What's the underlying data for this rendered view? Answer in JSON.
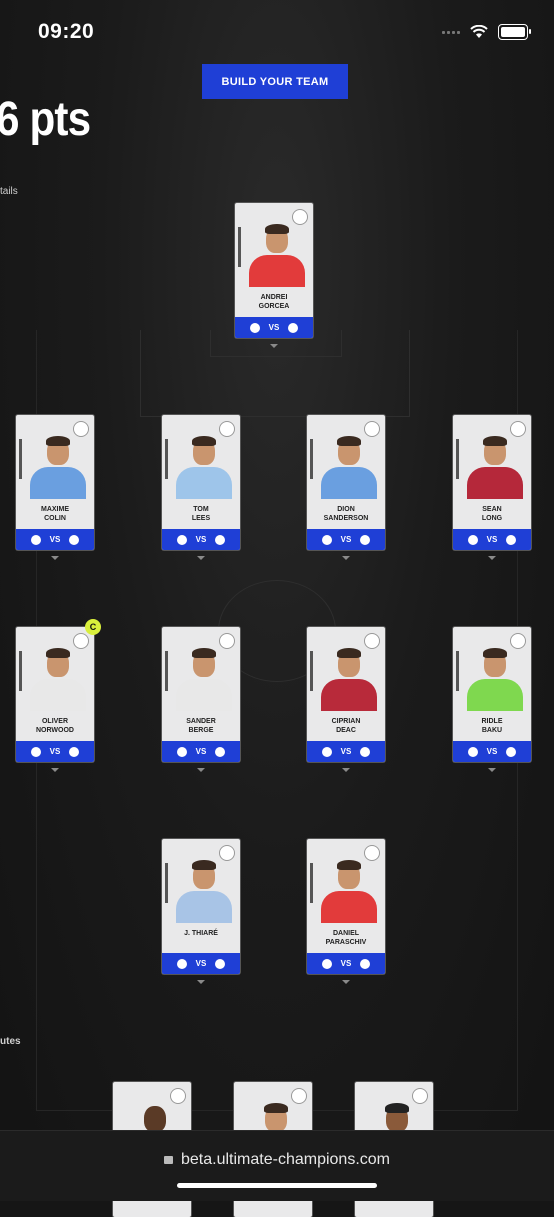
{
  "status_bar": {
    "time": "09:20"
  },
  "header": {
    "build_button": "BUILD YOUR TEAM",
    "points_text": "6 pts",
    "details_text": "tails"
  },
  "subs_label": "utes",
  "players": [
    {
      "id": "gk",
      "first": "ANDREI",
      "last": "GORCEA",
      "shirt": "#e23b3b",
      "crest": "U",
      "home": "U",
      "away": "⚑"
    },
    {
      "id": "d1",
      "first": "MAXIME",
      "last": "COLIN",
      "shirt": "#6a9fe0",
      "crest": "",
      "home": "",
      "away": "●"
    },
    {
      "id": "d2",
      "first": "TOM",
      "last": "LEES",
      "shirt": "#9ec5ea",
      "crest": "",
      "home": "",
      "away": "●"
    },
    {
      "id": "d3",
      "first": "DION",
      "last": "SANDERSON",
      "shirt": "#6a9fe0",
      "crest": "",
      "home": "",
      "away": "●"
    },
    {
      "id": "d4",
      "first": "SEAN",
      "last": "LONG",
      "shirt": "#b5283a",
      "crest": "",
      "home": "",
      "away": "●"
    },
    {
      "id": "m1",
      "first": "OLIVER",
      "last": "NORWOOD",
      "shirt": "#e8e8e8",
      "crest": "",
      "home": "",
      "away": "●"
    },
    {
      "id": "m2",
      "first": "SANDER",
      "last": "BERGE",
      "shirt": "#e8e8e8",
      "crest": "",
      "home": "",
      "away": "●"
    },
    {
      "id": "m3",
      "first": "CIPRIAN",
      "last": "DEAC",
      "shirt": "#b82a3a",
      "crest": "",
      "home": "",
      "away": "●"
    },
    {
      "id": "m4",
      "first": "RIDLE",
      "last": "BAKU",
      "shirt": "#7fd84f",
      "crest": "W",
      "home": "",
      "away": "W"
    },
    {
      "id": "f1",
      "first": "",
      "last": "J. THIARÉ",
      "shirt": "#a8c4e6",
      "crest": "",
      "home": "",
      "away": "●"
    },
    {
      "id": "f2",
      "first": "DANIEL",
      "last": "PARASCHIV",
      "shirt": "#e23b3b",
      "crest": "",
      "home": "U",
      "away": "⚑"
    }
  ],
  "vs_label": "VS",
  "captain_label": "C",
  "browser": {
    "url": "beta.ultimate-champions.com"
  }
}
